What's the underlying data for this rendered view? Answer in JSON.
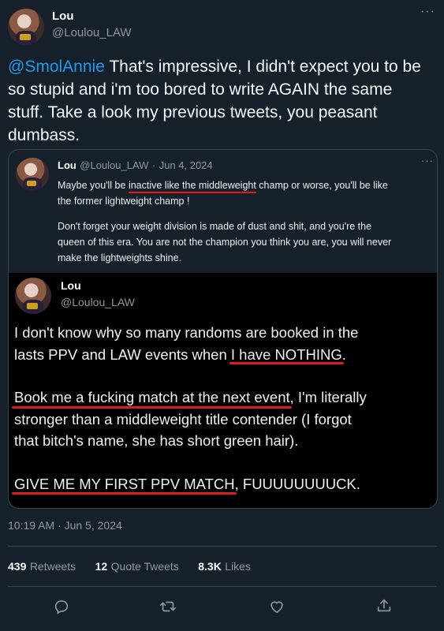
{
  "author": {
    "name": "Lou",
    "handle": "@Loulou_LAW"
  },
  "more_glyph": "···",
  "tweet": {
    "mention": "@SmolAnnie",
    "line1_rest": " That's impressive, I didn't expect you to be",
    "line2": "so stupid and i'm too bored to write AGAIN the same",
    "line3": "stuff. Take a look my previous tweets, you peasant",
    "line4": "dumbass."
  },
  "quote": {
    "name": "Lou",
    "handle": "@Loulou_LAW",
    "separator": "·",
    "date": "Jun 4, 2024",
    "p1_a": "Maybe you'll be ",
    "p1_ul": "inactive like the middleweight",
    "p1_b": " champ or worse, you'll be like",
    "p1_line2": "the former lightweight champ !",
    "p2_line1": "Don't forget your weight division is made of dust and shit, and you're the",
    "p2_line2": "queen of this era. You are not the champion you think you are, you will never",
    "p2_line3": "make the lightweights shine."
  },
  "inner_tweet": {
    "name": "Lou",
    "handle": "@Loulou_LAW",
    "l1": "I don't know why so many randoms are booked in the",
    "l2_a": "lasts PPV and LAW events when ",
    "l2_ul": "I have NOTHING",
    "l2_b": ".",
    "l3_ul": "Book me a fucking match at the next event",
    "l3_b": ", I'm literally",
    "l4": "stronger than a middleweight title contender (I forgot",
    "l5": "that bitch's name, she has short green hair).",
    "l6_ul": "GIVE ME MY FIRST PPV MATCH",
    "l6_b": ", FUUUUUUUUCK."
  },
  "timestamp": "10:19 AM · Jun 5, 2024",
  "stats": {
    "retweets_num": "439",
    "retweets_lbl": "Retweets",
    "quotes_num": "12",
    "quotes_lbl": "Quote Tweets",
    "likes_num": "8.3K",
    "likes_lbl": "Likes"
  },
  "colors": {
    "background": "#15202b",
    "accent": "#1d9bf0",
    "underline": "#e0191b",
    "muted": "#8b98a5",
    "border": "#38444d"
  },
  "icons": [
    "more-icon",
    "reply-icon",
    "retweet-icon",
    "like-icon",
    "share-icon"
  ]
}
